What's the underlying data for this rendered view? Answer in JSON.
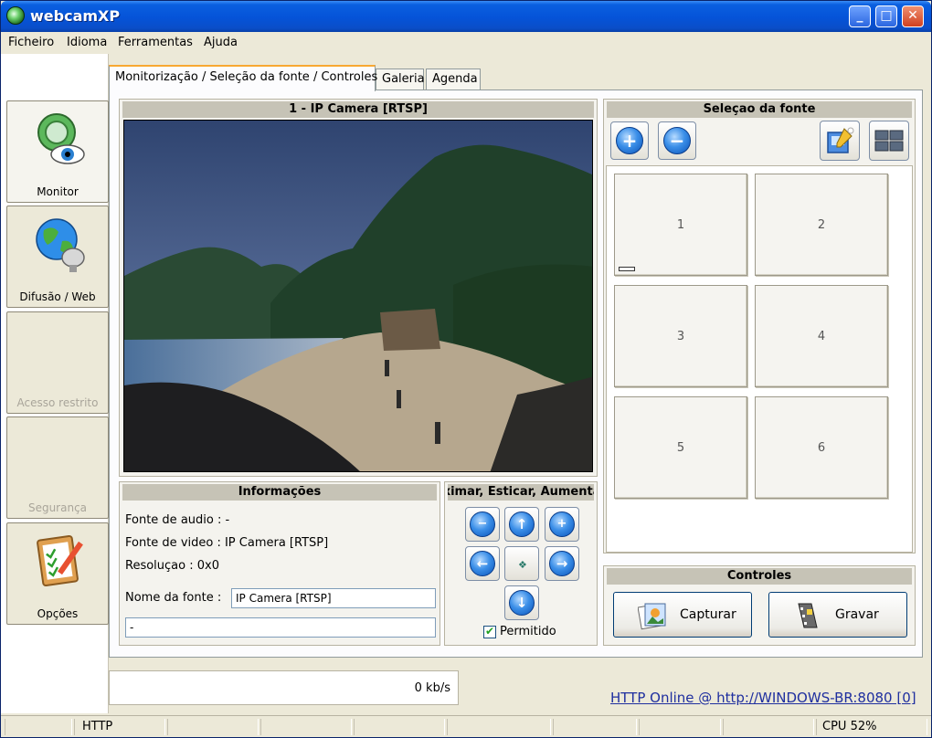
{
  "window": {
    "title": "webcamXP",
    "minimize_label": "_",
    "maximize_label": "□",
    "close_label": "✕"
  },
  "menu": {
    "items": [
      "Ficheiro",
      "Idioma",
      "Ferramentas",
      "Ajuda"
    ]
  },
  "sidebar": {
    "items": [
      {
        "label": "Monitor",
        "icon": "monitor-eye-icon",
        "enabled": true
      },
      {
        "label": "Difusão / Web",
        "icon": "globe-dish-icon",
        "enabled": true
      },
      {
        "label": "Acesso restrito",
        "icon": "",
        "enabled": false
      },
      {
        "label": "Segurança",
        "icon": "",
        "enabled": false
      },
      {
        "label": "Opções",
        "icon": "clipboard-icon",
        "enabled": true
      }
    ]
  },
  "tabs": [
    "Monitorização / Seleção da fonte / Controles",
    "Galeria",
    "Agenda"
  ],
  "camera": {
    "title": "1 - IP Camera [RTSP]"
  },
  "info": {
    "title": "Informações",
    "audio": "Fonte de audio : -",
    "video": "Fonte de video : IP Camera [RTSP]",
    "resolution": "Resoluçao : 0x0",
    "name_label": "Nome da fonte :",
    "name_value": "IP Camera [RTSP]",
    "extra_value": "-"
  },
  "ptz": {
    "title": "Aproximar, Esticar, Aumentar",
    "zoom_out_glyph": "−",
    "zoom_in_glyph": "+",
    "up_glyph": "↑",
    "left_glyph": "←",
    "center_glyph": "❖",
    "right_glyph": "→",
    "down_glyph": "↓",
    "allowed_label": "Permitido",
    "allowed_checked": true,
    "check_glyph": "✔"
  },
  "sources": {
    "title": "Seleçao da fonte",
    "add_glyph": "+",
    "remove_glyph": "−",
    "slots": [
      "1",
      "2",
      "3",
      "4",
      "5",
      "6"
    ]
  },
  "controls": {
    "title": "Controles",
    "capture_label": "Capturar",
    "record_label": "Gravar"
  },
  "rate": "0 kb/s",
  "http_link": "HTTP Online @ http://WINDOWS-BR:8080 [0]",
  "status": {
    "protocol": "HTTP",
    "cpu": "CPU 52%"
  },
  "colors": {
    "title_bar": "#0553d8",
    "tab_accent": "#f8a832",
    "link": "#1f2f9f"
  }
}
